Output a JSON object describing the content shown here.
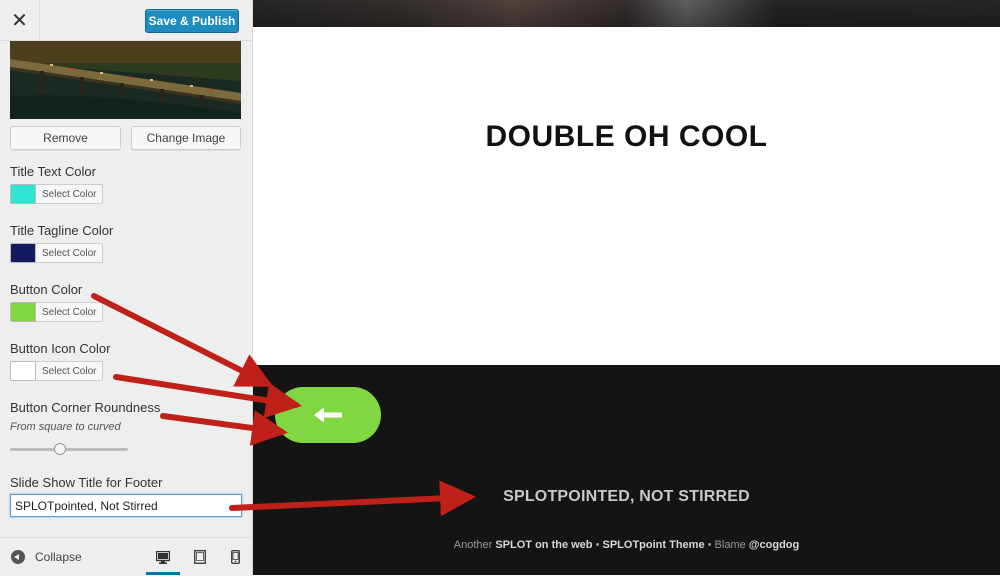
{
  "topbar": {
    "close_glyph": "✕",
    "save_label": "Save & Publish"
  },
  "header_image": {
    "remove_label": "Remove",
    "change_label": "Change Image"
  },
  "controls": {
    "title_text_color": {
      "label": "Title Text Color",
      "button": "Select Color",
      "color": "#2ee5d4"
    },
    "title_tagline_color": {
      "label": "Title Tagline Color",
      "button": "Select Color",
      "color": "#141a5f"
    },
    "button_color": {
      "label": "Button Color",
      "button": "Select Color",
      "color": "#81d742"
    },
    "button_icon_color": {
      "label": "Button Icon Color",
      "button": "Select Color",
      "color": "#ffffff"
    },
    "corner_roundness": {
      "label": "Button Corner Roundness",
      "description": "From square to curved",
      "value_fraction": 0.42
    },
    "footer_title": {
      "label": "Slide Show Title for Footer",
      "value": "SPLOTpointed, Not Stirred"
    }
  },
  "bottom_bar": {
    "collapse_label": "Collapse",
    "devices": [
      "desktop-icon",
      "tablet-icon",
      "mobile-icon"
    ],
    "active_device": "desktop"
  },
  "preview": {
    "site_title": "DOUBLE OH COOL",
    "footer_title": "SPLOTPOINTED, NOT STIRRED",
    "credits": {
      "w1": "Another",
      "b1": "SPLOT on the web",
      "sep1": "•",
      "b2": "SPLOTpoint Theme",
      "sep2": "•",
      "w2": "Blame",
      "b3": "@cogdog"
    },
    "button_icon": "left-arrow-icon"
  },
  "colors": {
    "primary_button": "#1e8cbe",
    "accent_green": "#81d742",
    "annotation_arrow": "#c0201a",
    "footer_bg": "#141414"
  }
}
